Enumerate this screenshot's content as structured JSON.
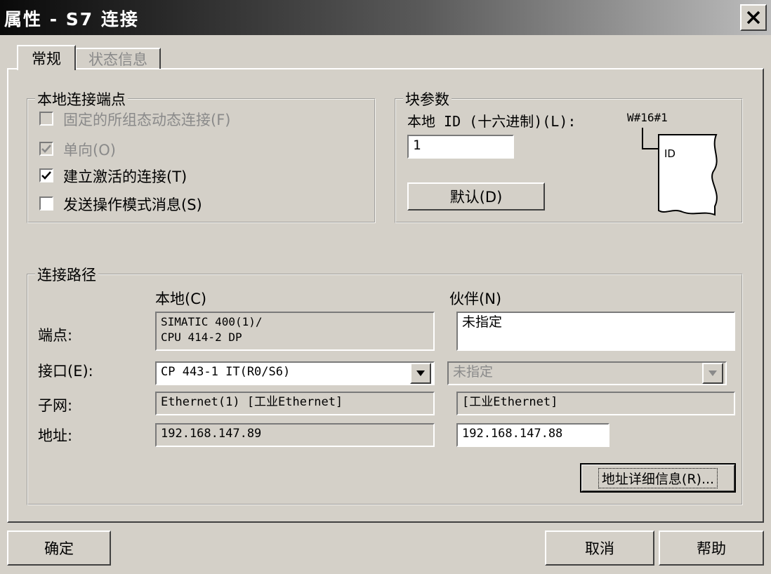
{
  "window": {
    "title": "属性 - S7 连接"
  },
  "tabs": [
    {
      "label": "常规"
    },
    {
      "label": "状态信息"
    }
  ],
  "local_endpoint": {
    "legend": "本地连接端点",
    "options": [
      {
        "label": "固定的所组态动态连接(F)",
        "checked": false,
        "enabled": false
      },
      {
        "label": "单向(O)",
        "checked": true,
        "enabled": false
      },
      {
        "label": "建立激活的连接(T)",
        "checked": true,
        "enabled": true
      },
      {
        "label": "发送操作模式消息(S)",
        "checked": false,
        "enabled": true
      }
    ]
  },
  "block_params": {
    "legend": "块参数",
    "local_id_label": "本地 ID (十六进制)(L):",
    "local_id_value": "1",
    "default_button": "默认(D)",
    "wdef": "W#16#1",
    "diagram_label": "ID"
  },
  "path": {
    "legend": "连接路径",
    "col_local": "本地(C)",
    "col_partner": "伙伴(N)",
    "row_endpoint": "端点:",
    "row_interface": "接口(E):",
    "row_subnet": "子网:",
    "row_address": "地址:",
    "local_endpoint_line1": "SIMATIC 400(1)/",
    "local_endpoint_line2": "CPU 414-2 DP",
    "partner_endpoint": "未指定",
    "local_interface": "CP 443-1 IT(R0/S6)",
    "partner_interface": "未指定",
    "local_subnet": "Ethernet(1) [工业Ethernet]",
    "partner_subnet": "[工业Ethernet]",
    "local_address": "192.168.147.89",
    "partner_address": "192.168.147.88",
    "address_details_button": "地址详细信息(R)..."
  },
  "footer": {
    "ok": "确定",
    "cancel": "取消",
    "help": "帮助"
  }
}
